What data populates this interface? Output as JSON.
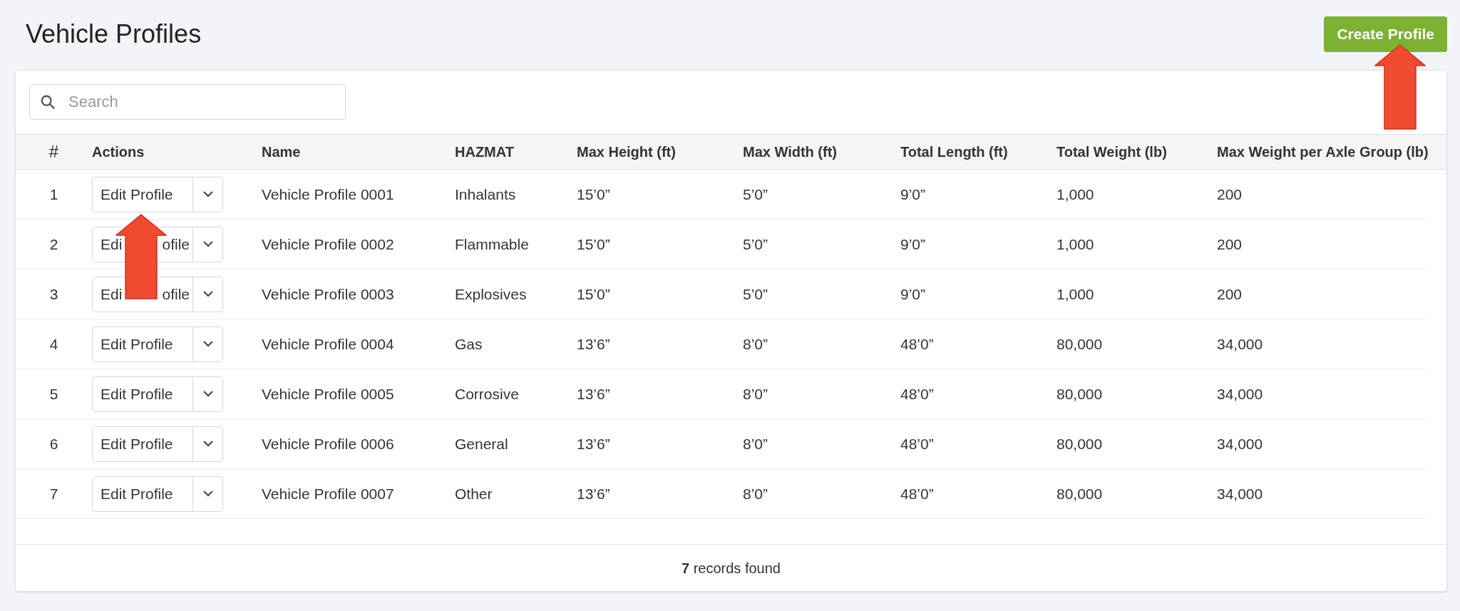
{
  "page": {
    "title": "Vehicle Profiles",
    "create_button": "Create Profile"
  },
  "search": {
    "placeholder": "Search"
  },
  "table": {
    "columns": [
      "#",
      "Actions",
      "Name",
      "HAZMAT",
      "Max Height (ft)",
      "Max Width (ft)",
      "Total Length (ft)",
      "Total Weight (lb)",
      "Max Weight per Axle Group (lb)"
    ],
    "rows": [
      {
        "index": "1",
        "action": "Edit Profile",
        "name": "Vehicle Profile 0001",
        "hazmat": "Inhalants",
        "max_height": "15’0”",
        "max_width": "5’0”",
        "total_length": "9’0”",
        "total_weight": "1,000",
        "max_axle_weight": "200"
      },
      {
        "index": "2",
        "action_visible": [
          "Edi",
          "ofile"
        ],
        "name": "Vehicle Profile 0002",
        "hazmat": "Flammable",
        "max_height": "15’0”",
        "max_width": "5’0”",
        "total_length": "9’0”",
        "total_weight": "1,000",
        "max_axle_weight": "200"
      },
      {
        "index": "3",
        "action_visible": [
          "Edi",
          "ofile"
        ],
        "name": "Vehicle Profile 0003",
        "hazmat": "Explosives",
        "max_height": "15’0”",
        "max_width": "5’0”",
        "total_length": "9’0”",
        "total_weight": "1,000",
        "max_axle_weight": "200"
      },
      {
        "index": "4",
        "action": "Edit Profile",
        "name": "Vehicle Profile 0004",
        "hazmat": "Gas",
        "max_height": "13’6”",
        "max_width": "8’0”",
        "total_length": "48’0”",
        "total_weight": "80,000",
        "max_axle_weight": "34,000"
      },
      {
        "index": "5",
        "action": "Edit Profile",
        "name": "Vehicle Profile 0005",
        "hazmat": "Corrosive",
        "max_height": "13’6”",
        "max_width": "8’0”",
        "total_length": "48’0”",
        "total_weight": "80,000",
        "max_axle_weight": "34,000"
      },
      {
        "index": "6",
        "action": "Edit Profile",
        "name": "Vehicle Profile 0006",
        "hazmat": "General",
        "max_height": "13’6”",
        "max_width": "8’0”",
        "total_length": "48’0”",
        "total_weight": "80,000",
        "max_axle_weight": "34,000"
      },
      {
        "index": "7",
        "action": "Edit Profile",
        "name": "Vehicle Profile 0007",
        "hazmat": "Other",
        "max_height": "13’6”",
        "max_width": "8’0”",
        "total_length": "48’0”",
        "total_weight": "80,000",
        "max_axle_weight": "34,000"
      }
    ]
  },
  "footer": {
    "records": "**7** records found"
  }
}
